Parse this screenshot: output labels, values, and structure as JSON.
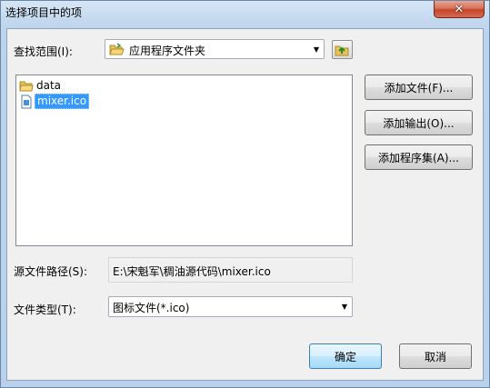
{
  "window": {
    "title": "选择项目中的项",
    "close_glyph": "✕"
  },
  "look_in": {
    "label": "查找范围(I):",
    "value": "应用程序文件夹"
  },
  "files": [
    {
      "name": "data",
      "icon": "folder-icon",
      "selected": false
    },
    {
      "name": "mixer.ico",
      "icon": "ico-file-icon",
      "selected": true
    }
  ],
  "buttons": {
    "add_file": "添加文件(F)...",
    "add_output": "添加输出(O)...",
    "add_assembly": "添加程序集(A)...",
    "ok": "确定",
    "cancel": "取消"
  },
  "source_path": {
    "label": "源文件路径(S):",
    "value": "E:\\宋魁军\\稠油源代码\\mixer.ico"
  },
  "file_type": {
    "label": "文件类型(T):",
    "value": "图标文件(*.ico)"
  },
  "colors": {
    "selection": "#3399ff",
    "close_button": "#c4442a",
    "default_button_border": "#3c7fb1"
  }
}
